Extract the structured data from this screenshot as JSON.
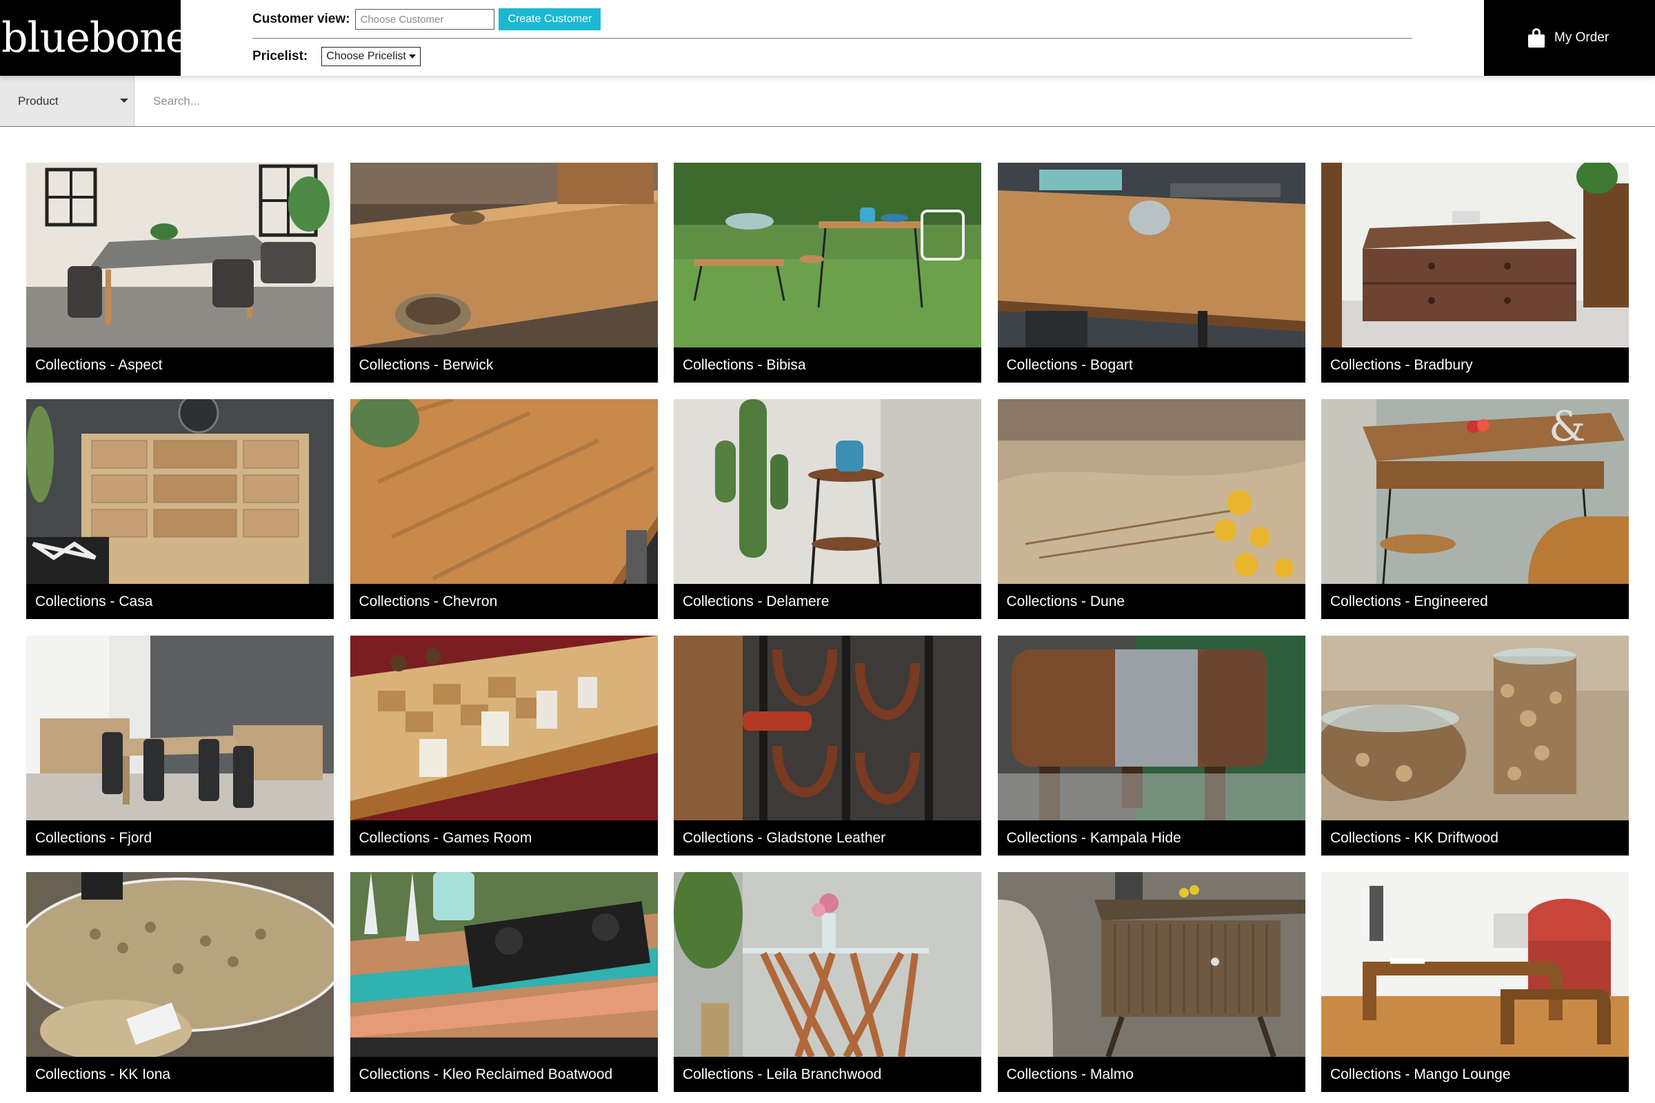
{
  "header": {
    "logo_text": "bluebone",
    "customer_label": "Customer view:",
    "customer_placeholder": "Choose Customer",
    "create_button": "Create Customer",
    "pricelist_label": "Pricelist:",
    "pricelist_value": "Choose Pricelist",
    "order_label": "My Order",
    "accent_color": "#1bb8d1"
  },
  "search": {
    "category_value": "Product",
    "placeholder": "Search..."
  },
  "collections": [
    {
      "label": "Collections - Aspect",
      "scene": "dining-room"
    },
    {
      "label": "Collections - Berwick",
      "scene": "rustic-table"
    },
    {
      "label": "Collections - Bibisa",
      "scene": "garden-furniture"
    },
    {
      "label": "Collections - Bogart",
      "scene": "wood-table-closeup"
    },
    {
      "label": "Collections - Bradbury",
      "scene": "coffee-table"
    },
    {
      "label": "Collections - Casa",
      "scene": "chest-of-drawers"
    },
    {
      "label": "Collections - Chevron",
      "scene": "table-corner"
    },
    {
      "label": "Collections - Delamere",
      "scene": "side-table-cactus"
    },
    {
      "label": "Collections - Dune",
      "scene": "resin-flowers"
    },
    {
      "label": "Collections - Engineered",
      "scene": "console-desk"
    },
    {
      "label": "Collections - Fjord",
      "scene": "dining-set"
    },
    {
      "label": "Collections - Games Room",
      "scene": "chess-board"
    },
    {
      "label": "Collections - Gladstone Leather",
      "scene": "wine-rack"
    },
    {
      "label": "Collections - Kampala Hide",
      "scene": "hide-stool"
    },
    {
      "label": "Collections - KK Driftwood",
      "scene": "driftwood-table"
    },
    {
      "label": "Collections - KK Iona",
      "scene": "glass-table"
    },
    {
      "label": "Collections - Kleo Reclaimed Boatwood",
      "scene": "dj-table"
    },
    {
      "label": "Collections - Leila Branchwood",
      "scene": "branch-console"
    },
    {
      "label": "Collections - Malmo",
      "scene": "bedside-unit"
    },
    {
      "label": "Collections - Mango Lounge",
      "scene": "nest-tables"
    }
  ]
}
